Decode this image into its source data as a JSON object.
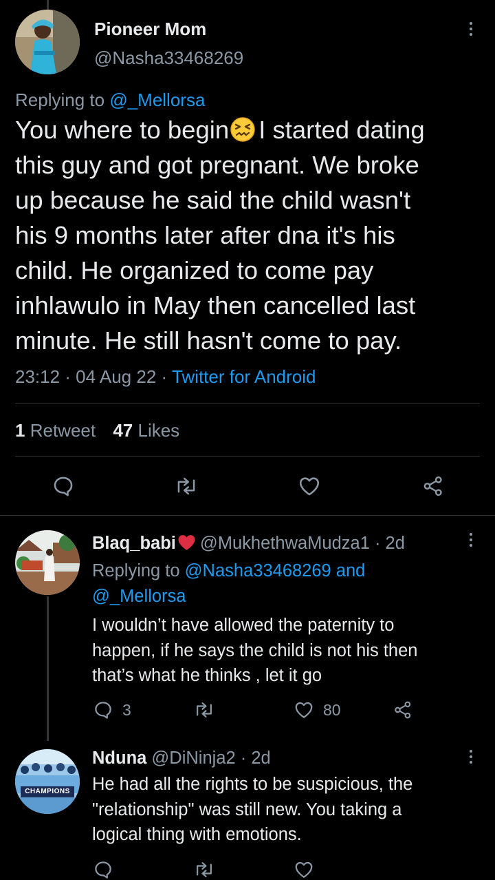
{
  "main_tweet": {
    "display_name": "Pioneer Mom",
    "handle": "@Nasha33468269",
    "replying_prefix": "Replying to",
    "replying_to": "@_Mellorsa",
    "text_lines": [
      "You where to begin",
      "I started dating",
      "this guy and got pregnant. We broke",
      "up because he said the child wasn't",
      "his 9 months later after dna it's his",
      "child. He organized to come pay",
      "inhlawulo in May then cancelled last",
      "minute. He still hasn't come to pay."
    ],
    "emoji": "confounded-face-emoji",
    "time": "23:12 · 04 Aug 22 ·",
    "source": "Twitter for Android",
    "retweet_count": "1",
    "retweet_label": "Retweet",
    "like_count": "47",
    "like_label": "Likes",
    "actions": [
      "reply-icon",
      "retweet-icon",
      "like-icon",
      "share-icon"
    ]
  },
  "replies": [
    {
      "display_name": "Blaq_babi",
      "name_badge": "red-heart-emoji",
      "handle_time": "@MukhethwaMudza1 · 2d",
      "replying_prefix": "Replying to",
      "replying_to_line1": "@Nasha33468269 and",
      "replying_to_line2": "@_Mellorsa",
      "text_lines": [
        "I wouldn’t have allowed the paternity to",
        "happen, if he says the child is not his then",
        "that’s what he thinks , let it go"
      ],
      "reply_count": "3",
      "like_count": "80"
    },
    {
      "display_name": "Nduna",
      "handle_time": "@DiNinja2 · 2d",
      "avatar_text": "CHAMPIONS",
      "text_lines": [
        "He had all the rights to be suspicious, the",
        "\"relationship\" was still new. You taking a",
        "logical thing with emotions."
      ]
    }
  ],
  "colors": {
    "background": "#000000",
    "text": "#e7e9ea",
    "muted": "#8b98a5",
    "link": "#1d9bf0",
    "heart": "#f91880"
  }
}
